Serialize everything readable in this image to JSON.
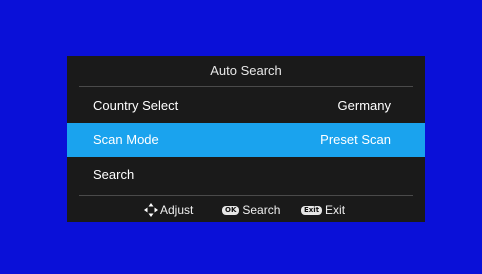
{
  "dialog": {
    "title": "Auto Search"
  },
  "rows": [
    {
      "label": "Country Select",
      "value": "Germany"
    },
    {
      "label": "Scan Mode",
      "value": "Preset Scan"
    },
    {
      "label": "Search",
      "value": ""
    }
  ],
  "footer": {
    "adjust_label": "Adjust",
    "ok_key": "OK",
    "search_label": "Search",
    "exit_key": "Exit",
    "exit_label": "Exit"
  },
  "colors": {
    "background": "#0a10d8",
    "panel": "#1a1a1a",
    "highlight": "#1aa3ee"
  }
}
